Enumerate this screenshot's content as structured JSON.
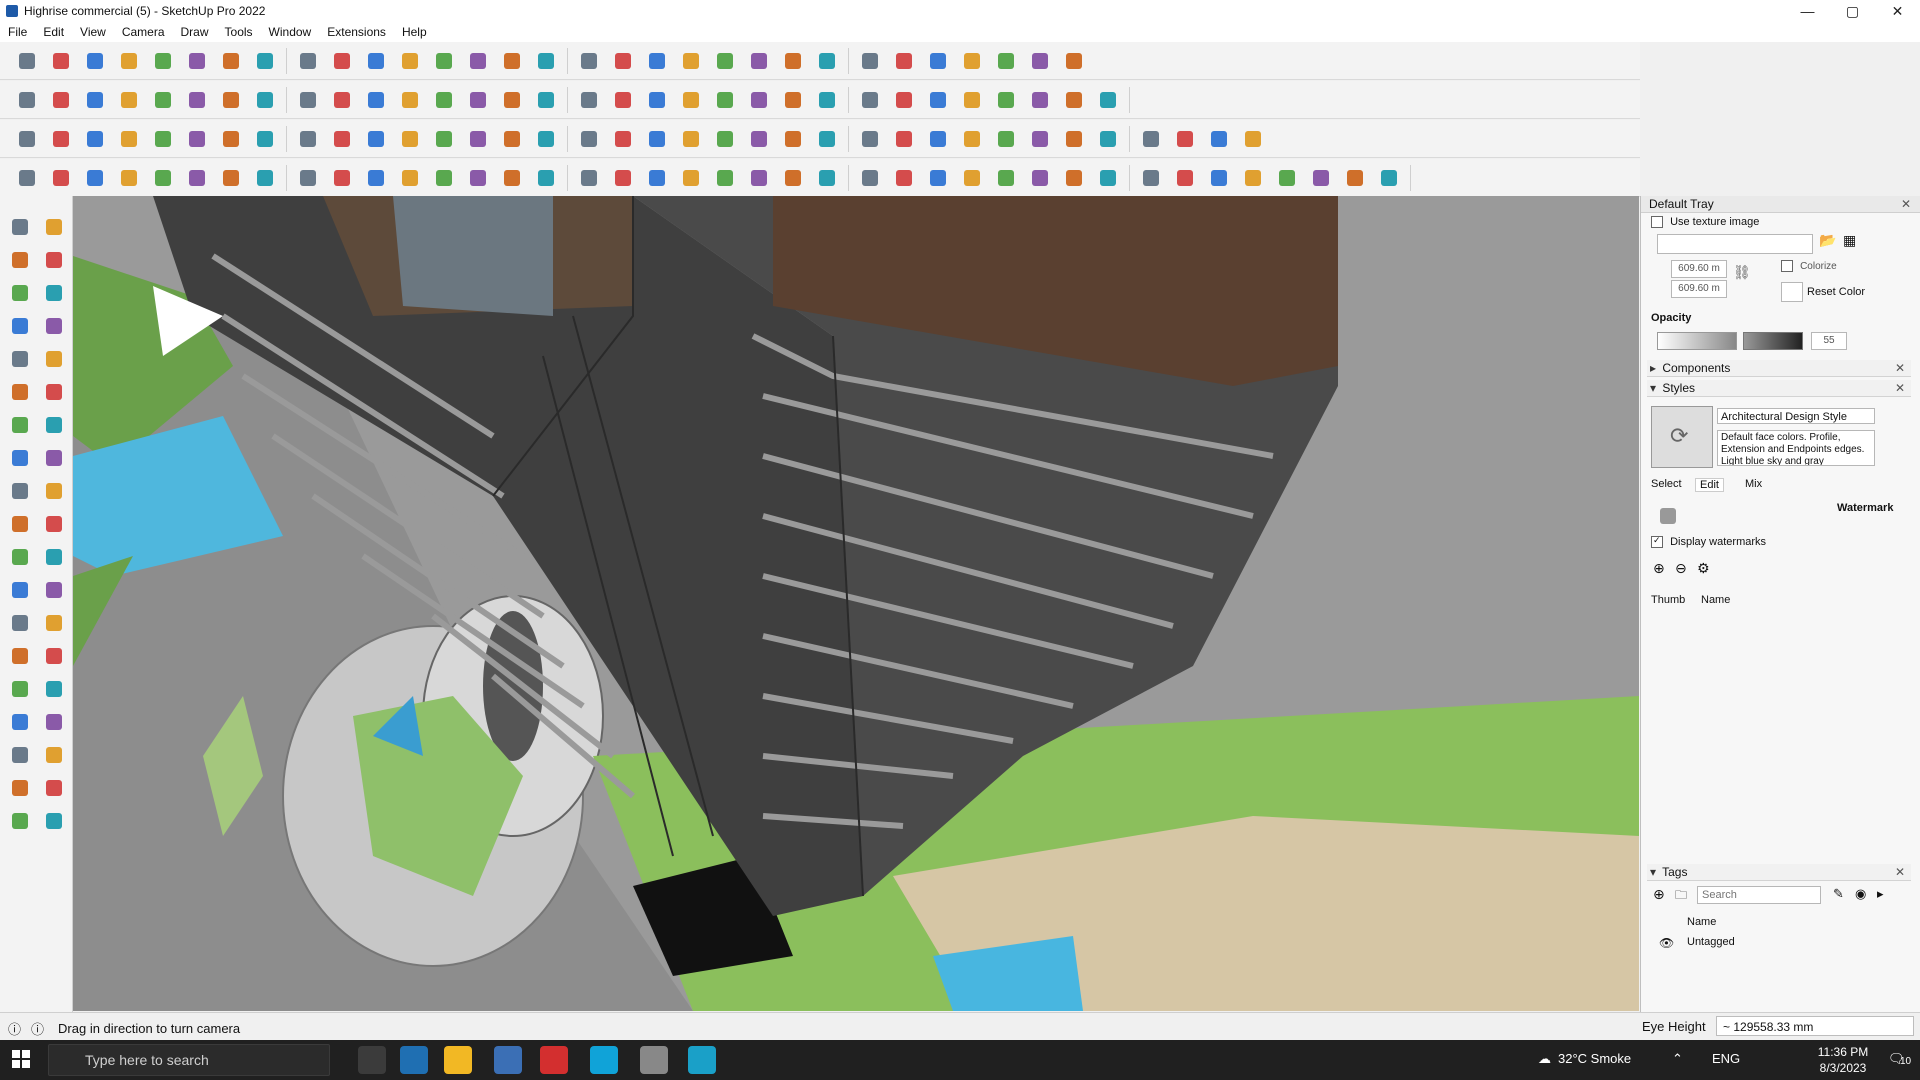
{
  "window": {
    "title": "Highrise commercial (5) - SketchUp Pro 2022",
    "controls": [
      "—",
      "▢",
      "✕"
    ]
  },
  "menubar": [
    "File",
    "Edit",
    "View",
    "Camera",
    "Draw",
    "Tools",
    "Window",
    "Extensions",
    "Help"
  ],
  "toolbars": {
    "row1_icons": [
      "search-icon",
      "select-icon",
      "eraser-icon",
      "pencil-icon",
      "lasso-icon",
      "paint-bucket-icon",
      "push-pull-icon",
      "follow-me-icon",
      "move-icon",
      "rotate-icon",
      "scale-icon",
      "tape-measure-icon",
      "text-icon",
      "section-plane-icon",
      "orbit-icon",
      "pan-icon",
      "zoom-icon",
      "zoom-extents-icon",
      "iso-view-icon",
      "top-view-icon",
      "front-view-icon",
      "right-view-icon",
      "user-icon",
      "component-icon",
      "group-icon",
      "flip-icon",
      "mirror-icon",
      "layout-icon",
      "undo-icon",
      "redo-icon",
      "warehouse-icon"
    ],
    "row2_icons": [
      "cube-iso-icon",
      "cube-xray-icon",
      "cube-shaded-icon",
      "plane-green-icon",
      "star-icon",
      "wall-icon",
      "wall-2-icon",
      "window-icon",
      "arc-icon",
      "push-icon",
      "arrow-left-icon",
      "arrow-right-icon",
      "arrow-up-icon",
      "arrow-down-icon",
      "arrow-ne-icon",
      "arrow-se-icon",
      "arrow-nw-icon",
      "building-icon",
      "house-1-icon",
      "house-2-icon",
      "house-3-icon",
      "house-4-icon",
      "house-5-icon",
      "roof-icon",
      "stair-icon",
      "brick-icon",
      "tile-icon",
      "texture-icon",
      "face-icon",
      "fredo-icon",
      "pencil-red-icon",
      "shape-icon"
    ],
    "row3_icons": [
      "layer-blue-icon",
      "layer-blue2-icon",
      "layer-yellow-icon",
      "layer-green-icon",
      "layer-red-icon",
      "layer-grey-icon",
      "orange-curve-icon",
      "red-square-icon",
      "grid-icon",
      "panel-icon",
      "crate-icon",
      "link-icon",
      "curve-icon",
      "node-icon",
      "cross-icon",
      "cross-green-icon",
      "cross-blue-icon",
      "cone-icon",
      "cone-2-icon",
      "warning-icon",
      "q-icon",
      "sun-icon",
      "sun-2-icon",
      "star-2-icon",
      "box-icon",
      "magnet-icon",
      "tree-icon",
      "path-icon",
      "path-2-icon",
      "gear-2-icon",
      "pattern-icon",
      "pattern-2-icon",
      "net-icon",
      "net-2-icon",
      "cross-red-icon",
      "spline-icon"
    ],
    "row4_icons": [
      "bezier-icon",
      "polyline-icon",
      "weld-icon",
      "scissors-icon",
      "gear-icon",
      "rotate-3d-icon",
      "torus-icon",
      "sphere-icon",
      "extrude-icon",
      "line-1-icon",
      "line-2-icon",
      "line-red-icon",
      "line-orange-icon",
      "box-2-icon",
      "tent-icon",
      "ribs-icon",
      "ribs-2-icon",
      "rib-3-icon",
      "dome-icon",
      "twist-icon",
      "fold-icon",
      "fold-2-icon",
      "fold-3-icon",
      "fold-4-icon",
      "fold-5-icon",
      "fold-6-icon",
      "fold-7-icon",
      "fold-8-icon",
      "fold-9-icon",
      "fold-10-icon",
      "fold-11-icon",
      "fold-12-icon",
      "fold-13-icon",
      "fold-14-icon",
      "fold-15-icon",
      "fold-16-icon",
      "fold-17-icon",
      "fold-18-icon",
      "fold-19-icon",
      "fold-20-icon"
    ]
  },
  "tray": {
    "title": "Default Tray",
    "use_texture": "Use texture image",
    "width_value": "609.60 m",
    "height_value": "609.60 m",
    "colorize": "Colorize",
    "reset_color": "Reset Color",
    "opacity_label": "Opacity",
    "opacity_value": "55",
    "components_label": "Components",
    "styles_label": "Styles",
    "style_name": "Architectural Design Style",
    "style_description": "Default face colors. Profile, Extension and Endpoints edges. Light blue sky and gray",
    "tabs": [
      "Select",
      "Edit",
      "Mix"
    ],
    "watermark_label": "Watermark",
    "display_watermarks": "Display watermarks",
    "col_thumb": "Thumb",
    "col_name": "Name",
    "tags_label": "Tags",
    "tags_search_placeholder": "Search",
    "tags_name_header": "Name",
    "tags_items": [
      "Untagged"
    ]
  },
  "statusbar": {
    "hint": "Drag in direction to turn camera",
    "measure_label": "Eye Height",
    "measure_value": "~ 129558.33 mm"
  },
  "taskbar": {
    "search_placeholder": "Type here to search",
    "weather": "32°C  Smoke",
    "lang": "ENG",
    "time": "11:36 PM",
    "date": "8/3/2023",
    "notification_count": "10"
  },
  "colors": {
    "accent": "#1e5aa8",
    "viewport_building": "#4a4a4a",
    "landscape_green": "#6aa04a",
    "water": "#48b6e0"
  }
}
